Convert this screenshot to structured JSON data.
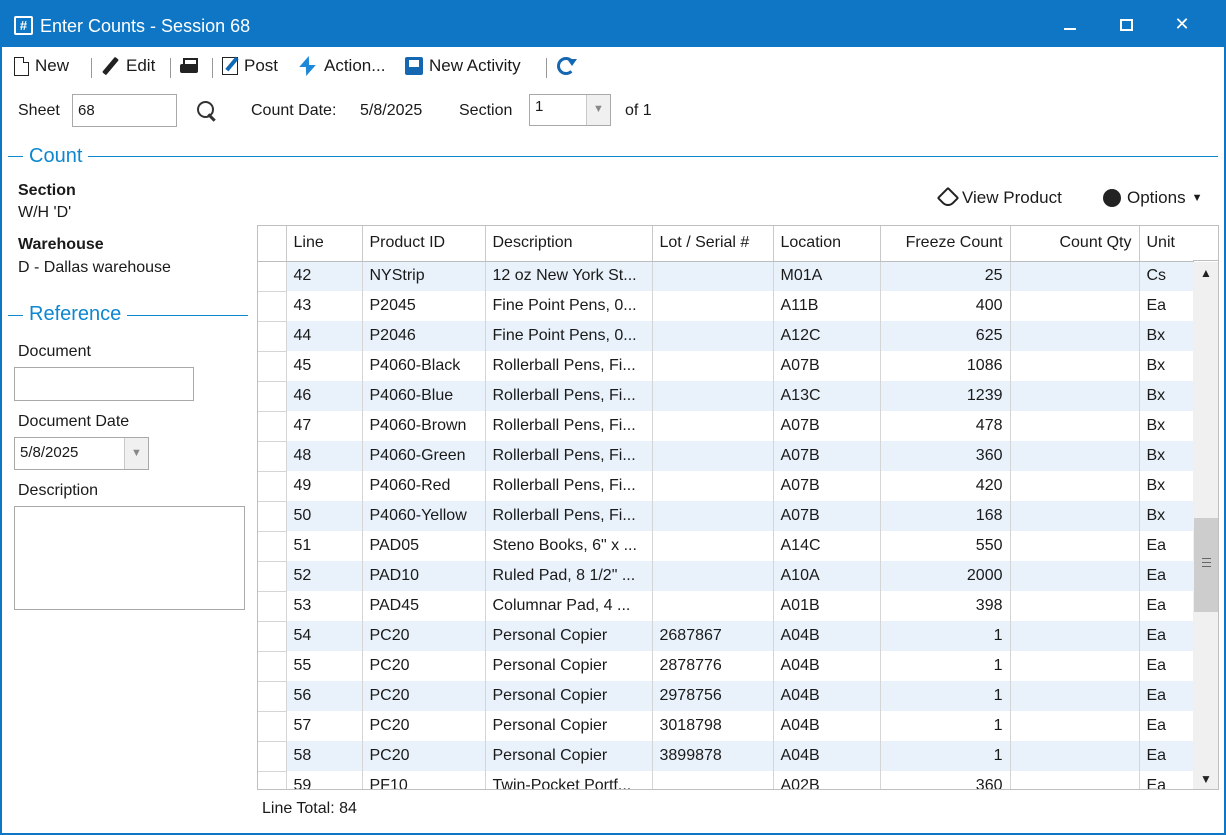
{
  "window": {
    "title": "Enter Counts - Session 68",
    "app_icon": "#"
  },
  "toolbar": {
    "new_label": "New",
    "edit_label": "Edit",
    "post_label": "Post",
    "action_label": "Action...",
    "new_activity_label": "New Activity"
  },
  "header": {
    "sheet_label": "Sheet",
    "sheet_value": "68",
    "count_date_label": "Count Date:",
    "count_date_value": "5/8/2025",
    "section_label": "Section",
    "section_value": "1",
    "section_of": "of 1"
  },
  "count_group": {
    "title": "Count",
    "section_label": "Section",
    "section_value": "W/H 'D'",
    "warehouse_label": "Warehouse",
    "warehouse_value": "D - Dallas warehouse"
  },
  "reference_group": {
    "title": "Reference",
    "document_label": "Document",
    "document_value": "",
    "document_date_label": "Document Date",
    "document_date_value": "5/8/2025",
    "description_label": "Description",
    "description_value": ""
  },
  "grid_actions": {
    "view_product": "View Product",
    "options": "Options"
  },
  "grid": {
    "columns": [
      "Line",
      "Product ID",
      "Description",
      "Lot / Serial #",
      "Location",
      "Freeze Count",
      "Count Qty",
      "Unit"
    ],
    "rows": [
      [
        "42",
        "NYStrip",
        "12 oz New York St...",
        "",
        "M01A",
        "25",
        "",
        "Cs"
      ],
      [
        "43",
        "P2045",
        "Fine Point Pens, 0...",
        "",
        "A11B",
        "400",
        "",
        "Ea"
      ],
      [
        "44",
        "P2046",
        "Fine Point Pens, 0...",
        "",
        "A12C",
        "625",
        "",
        "Bx"
      ],
      [
        "45",
        "P4060-Black",
        "Rollerball Pens, Fi...",
        "",
        "A07B",
        "1086",
        "",
        "Bx"
      ],
      [
        "46",
        "P4060-Blue",
        "Rollerball Pens, Fi...",
        "",
        "A13C",
        "1239",
        "",
        "Bx"
      ],
      [
        "47",
        "P4060-Brown",
        "Rollerball Pens, Fi...",
        "",
        "A07B",
        "478",
        "",
        "Bx"
      ],
      [
        "48",
        "P4060-Green",
        "Rollerball Pens, Fi...",
        "",
        "A07B",
        "360",
        "",
        "Bx"
      ],
      [
        "49",
        "P4060-Red",
        "Rollerball Pens, Fi...",
        "",
        "A07B",
        "420",
        "",
        "Bx"
      ],
      [
        "50",
        "P4060-Yellow",
        "Rollerball Pens, Fi...",
        "",
        "A07B",
        "168",
        "",
        "Bx"
      ],
      [
        "51",
        "PAD05",
        "Steno Books, 6\" x ...",
        "",
        "A14C",
        "550",
        "",
        "Ea"
      ],
      [
        "52",
        "PAD10",
        "Ruled Pad, 8 1/2\" ...",
        "",
        "A10A",
        "2000",
        "",
        "Ea"
      ],
      [
        "53",
        "PAD45",
        "Columnar Pad, 4 ...",
        "",
        "A01B",
        "398",
        "",
        "Ea"
      ],
      [
        "54",
        "PC20",
        "Personal Copier",
        "2687867",
        "A04B",
        "1",
        "",
        "Ea"
      ],
      [
        "55",
        "PC20",
        "Personal Copier",
        "2878776",
        "A04B",
        "1",
        "",
        "Ea"
      ],
      [
        "56",
        "PC20",
        "Personal Copier",
        "2978756",
        "A04B",
        "1",
        "",
        "Ea"
      ],
      [
        "57",
        "PC20",
        "Personal Copier",
        "3018798",
        "A04B",
        "1",
        "",
        "Ea"
      ],
      [
        "58",
        "PC20",
        "Personal Copier",
        "3899878",
        "A04B",
        "1",
        "",
        "Ea"
      ],
      [
        "59",
        "PF10",
        "Twin-Pocket Portf...",
        "",
        "A02B",
        "360",
        "",
        "Ea"
      ]
    ]
  },
  "footer": {
    "line_total": "Line Total: 84"
  },
  "colors": {
    "accent": "#0e76c4",
    "group_title": "#0e87d0",
    "alt_row": "#e9f2fb"
  }
}
